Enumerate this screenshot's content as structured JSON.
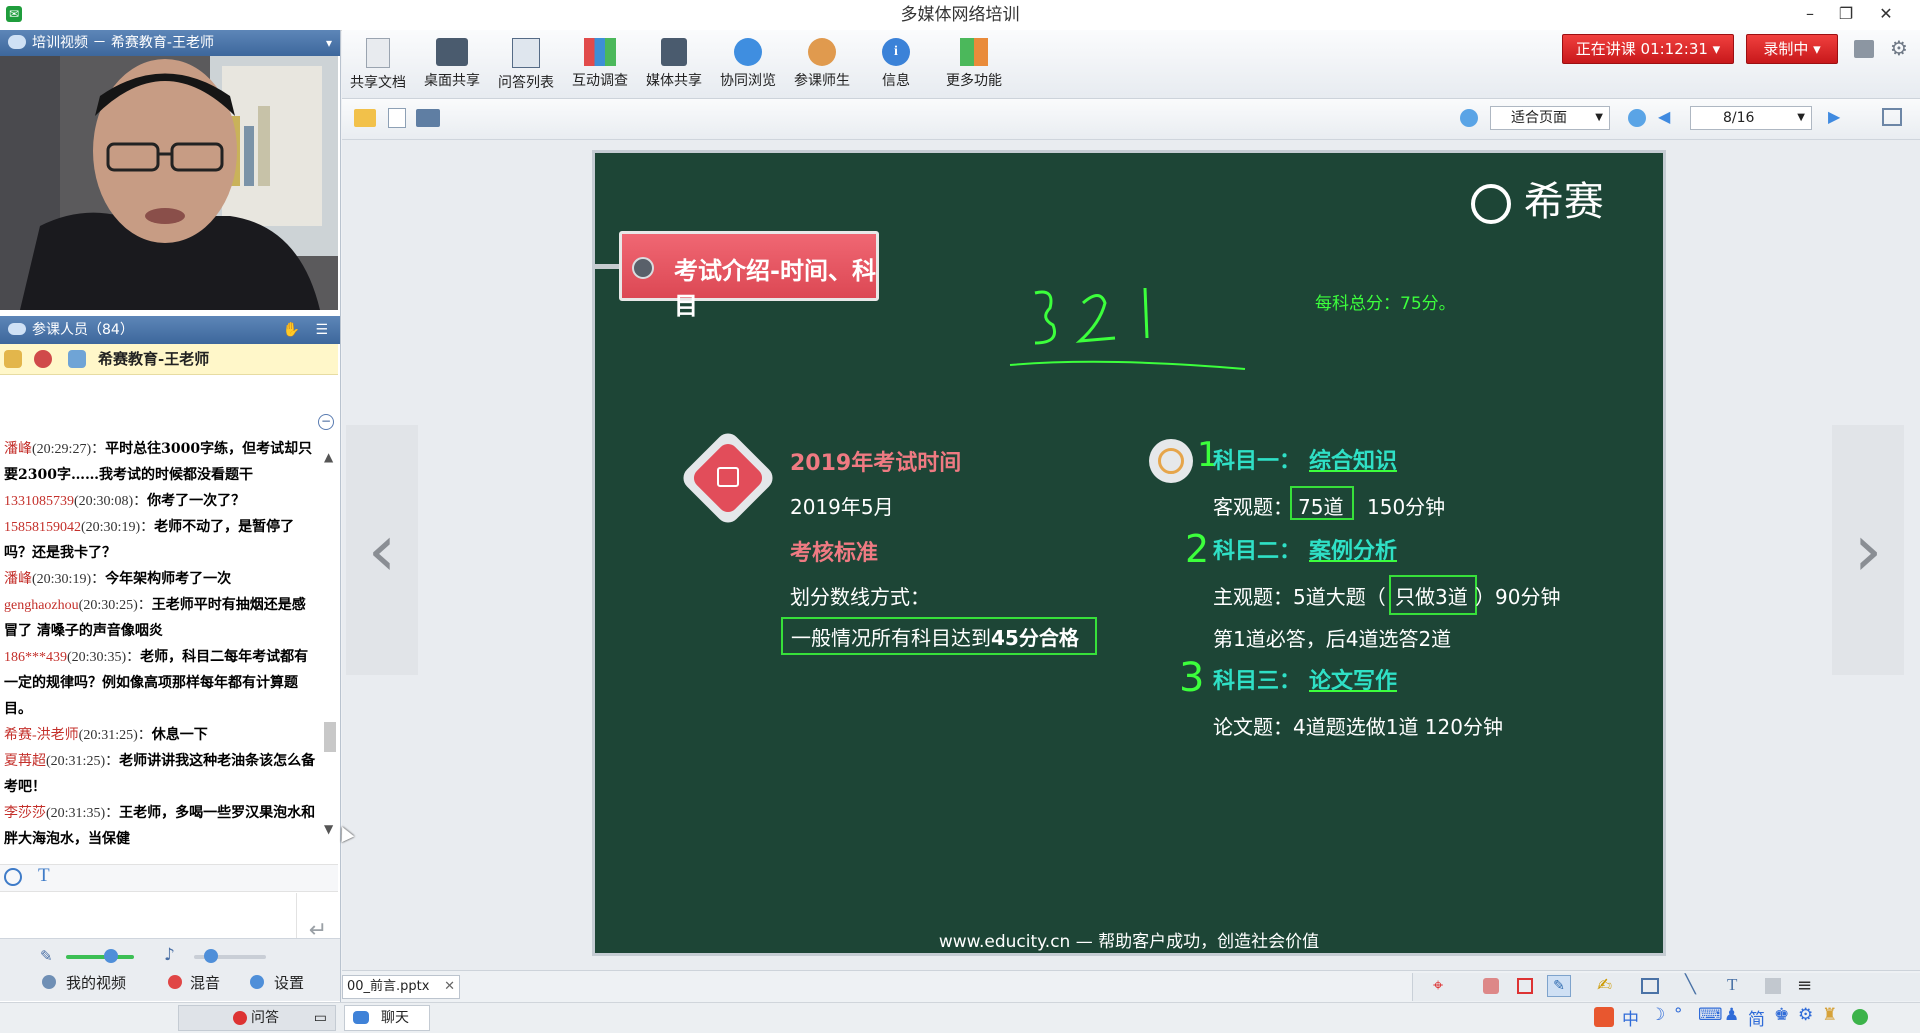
{
  "window": {
    "title": "多媒体网络培训",
    "minimize": "–",
    "restore": "❐",
    "close": "✕"
  },
  "left": {
    "video_header": "培训视频 － 希赛教育-王老师",
    "attendee_header": "参课人员（84）",
    "current_user": "希赛教育-王老师",
    "chat": [
      {
        "name": "潘峰",
        "time": "(20:29:27)：",
        "text": "平时总往3000字练，但考试却只要2300字……我考试的时候都没看题干"
      },
      {
        "name": "1331085739",
        "time": "(20:30:08)：",
        "text": "你考了一次了？"
      },
      {
        "name": "15858159042",
        "time": "(20:30:19)：",
        "text": "老师不动了，是暂停了吗？还是我卡了？"
      },
      {
        "name": "潘峰",
        "time": "(20:30:19)：",
        "text": "今年架构师考了一次"
      },
      {
        "name": "genghaozhou",
        "time": "(20:30:25)：",
        "text": "王老师平时有抽烟还是感冒了 清嗓子的声音像咽炎"
      },
      {
        "name": "186***439",
        "time": "(20:30:35)：",
        "text": "老师，科目二每年考试都有一定的规律吗？例如像高项那样每年都有计算题目。"
      },
      {
        "name": "希赛-洪老师",
        "time": "(20:31:25)：",
        "text": "休息一下"
      },
      {
        "name": "夏苒超",
        "time": "(20:31:25)：",
        "text": "老师讲讲我这种老油条该怎么备考吧！"
      },
      {
        "name": "李莎莎",
        "time": "(20:31:35)：",
        "text": "王老师，多喝一些罗汉果泡水和胖大海泡水，当保健"
      }
    ],
    "controls": {
      "my_video": "我的视频",
      "mix": "混音",
      "settings": "设置",
      "qa": "问答",
      "chat_tab": "聊天"
    }
  },
  "toolbar": {
    "items": [
      "共享文档",
      "桌面共享",
      "问答列表",
      "互动调查",
      "媒体共享",
      "协同浏览",
      "参课师生",
      "信息",
      "更多功能"
    ],
    "live_status": "正在讲课 01:12:31",
    "recording": "录制中",
    "fit_mode": "适合页面",
    "page": "8/16"
  },
  "doc_tab": "00_前言.pptx",
  "slide": {
    "logo": "希赛",
    "title": "考试介绍-时间、科目",
    "handwriting": "3 2 1",
    "total_note": "每科总分：75分。",
    "left_heading": "2019年考试时间",
    "left_date": "2019年5月",
    "standard_heading": "考核标准",
    "method": "划分数线方式：",
    "pass_rule_prefix": "一般情况所有科目达到",
    "pass_rule_bold": "45分合格",
    "subject1_label": "科目一：",
    "subject1_name": "综合知识",
    "subject1_detail_a": "客观题：",
    "subject1_detail_box": "75道",
    "subject1_detail_b": "150分钟",
    "subject2_label": "科目二：",
    "subject2_name": "案例分析",
    "subject2_detail_a": "主观题：5道大题（",
    "subject2_detail_box": "只做3道",
    "subject2_detail_b": "）90分钟",
    "subject2_detail2": "第1道必答，后4道选答2道",
    "subject3_label": "科目三：",
    "subject3_name": "论文写作",
    "subject3_detail": "论文题：4道题选做1道  120分钟",
    "footer": "www.educity.cn — 帮助客户成功，创造社会价值",
    "mark1": "1",
    "mark2": "2",
    "mark3": "3"
  },
  "colors": {
    "slide_bg": "#1d4536",
    "accent_red": "#e05661",
    "mark_green": "#3cff3c",
    "cyan": "#2fe0c6"
  }
}
